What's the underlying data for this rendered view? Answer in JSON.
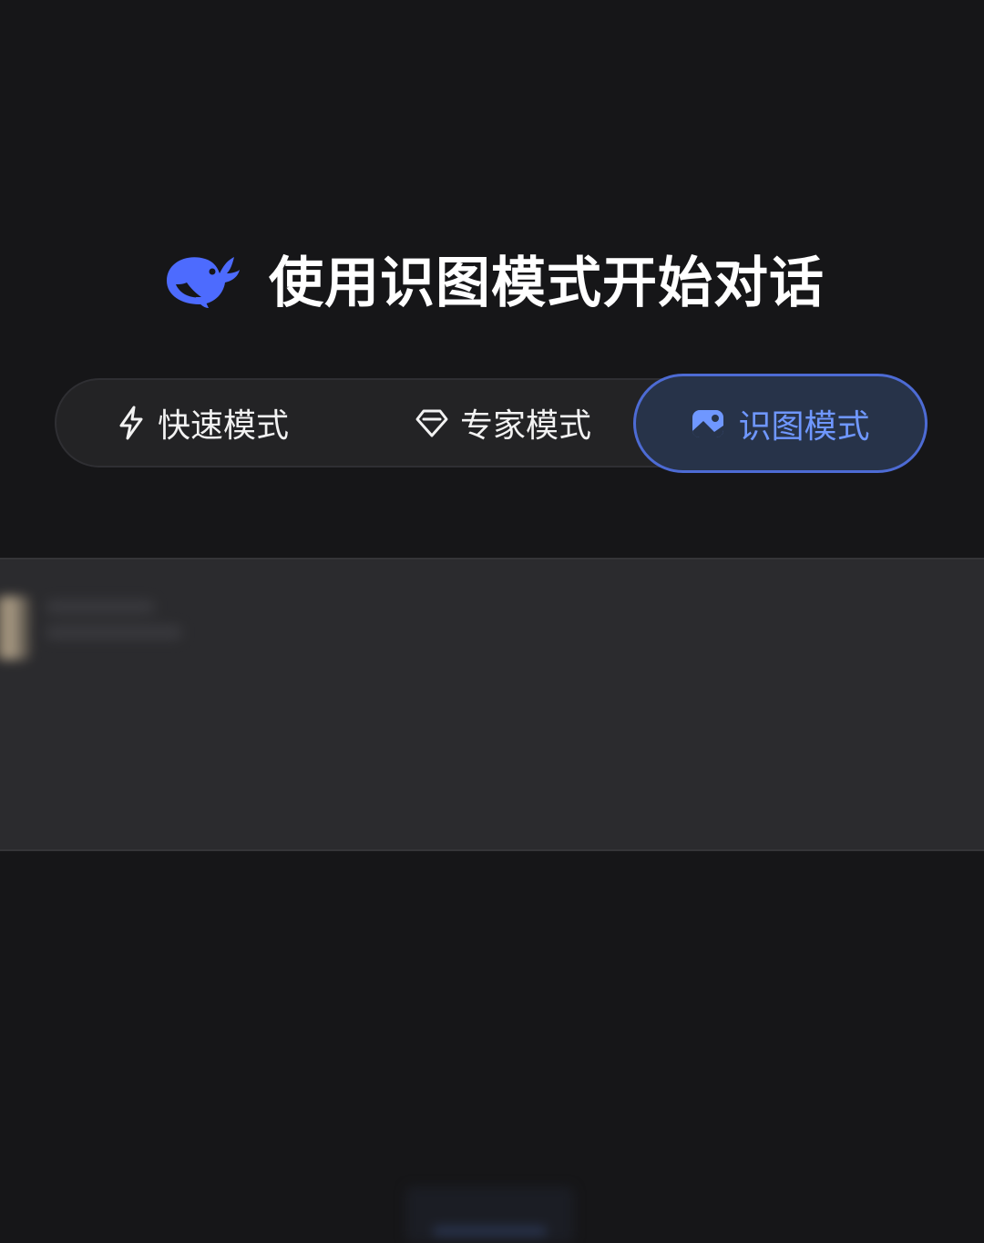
{
  "header": {
    "logo": "deepseek-whale-logo",
    "title": "使用识图模式开始对话"
  },
  "modes": [
    {
      "label": "快速模式",
      "icon": "lightning-icon",
      "selected": false
    },
    {
      "label": "专家模式",
      "icon": "diamond-icon",
      "selected": false
    },
    {
      "label": "识图模式",
      "icon": "image-icon",
      "selected": true
    }
  ],
  "colors": {
    "background": "#161618",
    "accent": "#6f97ff",
    "logo": "#4d6bfe",
    "selected_bg": "#273349",
    "selected_border": "#4d6bd4",
    "bar_bg": "#232325",
    "panel_bg": "#2b2b2e"
  }
}
